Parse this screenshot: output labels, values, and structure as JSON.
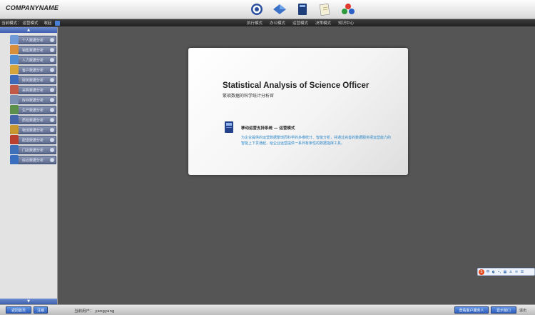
{
  "header": {
    "logo": "COMPANYNAME",
    "mode_icons": [
      "target-icon",
      "diamond-icon",
      "book-icon",
      "document-icon",
      "molecule-icon"
    ]
  },
  "navbar": {
    "current_mode_label": "当前模式：",
    "current_mode_value": "运营模式",
    "collapse_label": "收起",
    "modes": [
      "执行模式",
      "办公模式",
      "运营模式",
      "决策模式",
      "知识中心"
    ]
  },
  "sidebar": {
    "items": [
      {
        "label": "个人数据分析",
        "icon": "person-search-icon",
        "color": "#6f9ad6"
      },
      {
        "label": "销售数据分析",
        "icon": "cart-icon",
        "color": "#d98e3b"
      },
      {
        "label": "人力数据分析",
        "icon": "people-icon",
        "color": "#4f8cd2"
      },
      {
        "label": "客户数据分析",
        "icon": "customer-icon",
        "color": "#d5a53c"
      },
      {
        "label": "财务数据分析",
        "icon": "finance-doc-icon",
        "color": "#3f69b9"
      },
      {
        "label": "采购数据分析",
        "icon": "purchase-icon",
        "color": "#c15a49"
      },
      {
        "label": "库存数据分析",
        "icon": "warehouse-icon",
        "color": "#7a8fb2"
      },
      {
        "label": "生产数据分析",
        "icon": "factory-icon",
        "color": "#5b8f4b"
      },
      {
        "label": "质检数据分析",
        "icon": "inspection-icon",
        "color": "#4466a8"
      },
      {
        "label": "物流数据分析",
        "icon": "logistics-icon",
        "color": "#c9972f"
      },
      {
        "label": "配送数据分析",
        "icon": "delivery-icon",
        "color": "#b9402f"
      },
      {
        "label": "门店数据分析",
        "icon": "store-icon",
        "color": "#3d70b8"
      },
      {
        "label": "综合数据分析",
        "icon": "info-icon",
        "color": "#3a6fc0"
      }
    ]
  },
  "dialog": {
    "title": "Statistical Analysis of Science Officer",
    "subtitle": "繁琐数据的科学统计分析官",
    "heading": "移动运营支持系统  —  运营模式",
    "description": "为企业提供的运营数据繁琐而科学的多维统计、智能分析，并通过完善的数据服务把运营能力的智能上下贯通起，给企业运营提供一系列有条性的数据指挥工具。"
  },
  "float_toolbar": {
    "logo": "S",
    "items": [
      "中",
      "◐",
      "•,",
      "▦",
      "♙",
      "♔",
      "☰"
    ]
  },
  "footer": {
    "btn_home": "返回首页",
    "btn_logout": "注销",
    "current_user_label": "当前用户：",
    "current_user": "yangyang",
    "btn_admin": "查看客户服务人",
    "btn_notice": "显示窗口",
    "exit": "退出"
  }
}
